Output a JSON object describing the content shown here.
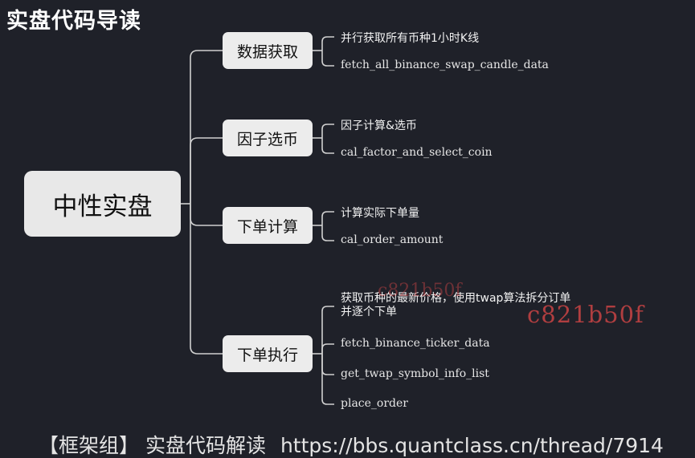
{
  "title": "实盘代码导读",
  "mindmap": {
    "root": {
      "label": "中性实盘"
    },
    "branches": [
      {
        "label": "数据获取",
        "leaves": [
          {
            "text": "并行获取所有币种1小时K线",
            "kind": "text"
          },
          {
            "text": "fetch_all_binance_swap_candle_data",
            "kind": "code"
          }
        ]
      },
      {
        "label": "因子选币",
        "leaves": [
          {
            "text": "因子计算&选币",
            "kind": "text"
          },
          {
            "text": "cal_factor_and_select_coin",
            "kind": "code"
          }
        ]
      },
      {
        "label": "下单计算",
        "leaves": [
          {
            "text": "计算实际下单量",
            "kind": "text"
          },
          {
            "text": "cal_order_amount",
            "kind": "code"
          }
        ]
      },
      {
        "label": "下单执行",
        "leaves": [
          {
            "text": "获取币种的最新价格，使用twap算法拆分订单并逐个下单",
            "kind": "text"
          },
          {
            "text": "fetch_binance_ticker_data",
            "kind": "code"
          },
          {
            "text": "get_twap_symbol_info_list",
            "kind": "code"
          },
          {
            "text": "place_order",
            "kind": "code"
          }
        ]
      }
    ]
  },
  "watermarks": [
    "c821b50f",
    "c821b50f"
  ],
  "footer": {
    "label": "【框架组】 实盘代码解读",
    "url": "https://bbs.quantclass.cn/thread/7914"
  },
  "colors": {
    "background": "#1f2129",
    "node_fill": "#ececec",
    "node_text": "#111111",
    "connector": "#d0d0d0",
    "watermark": "#e24848"
  }
}
